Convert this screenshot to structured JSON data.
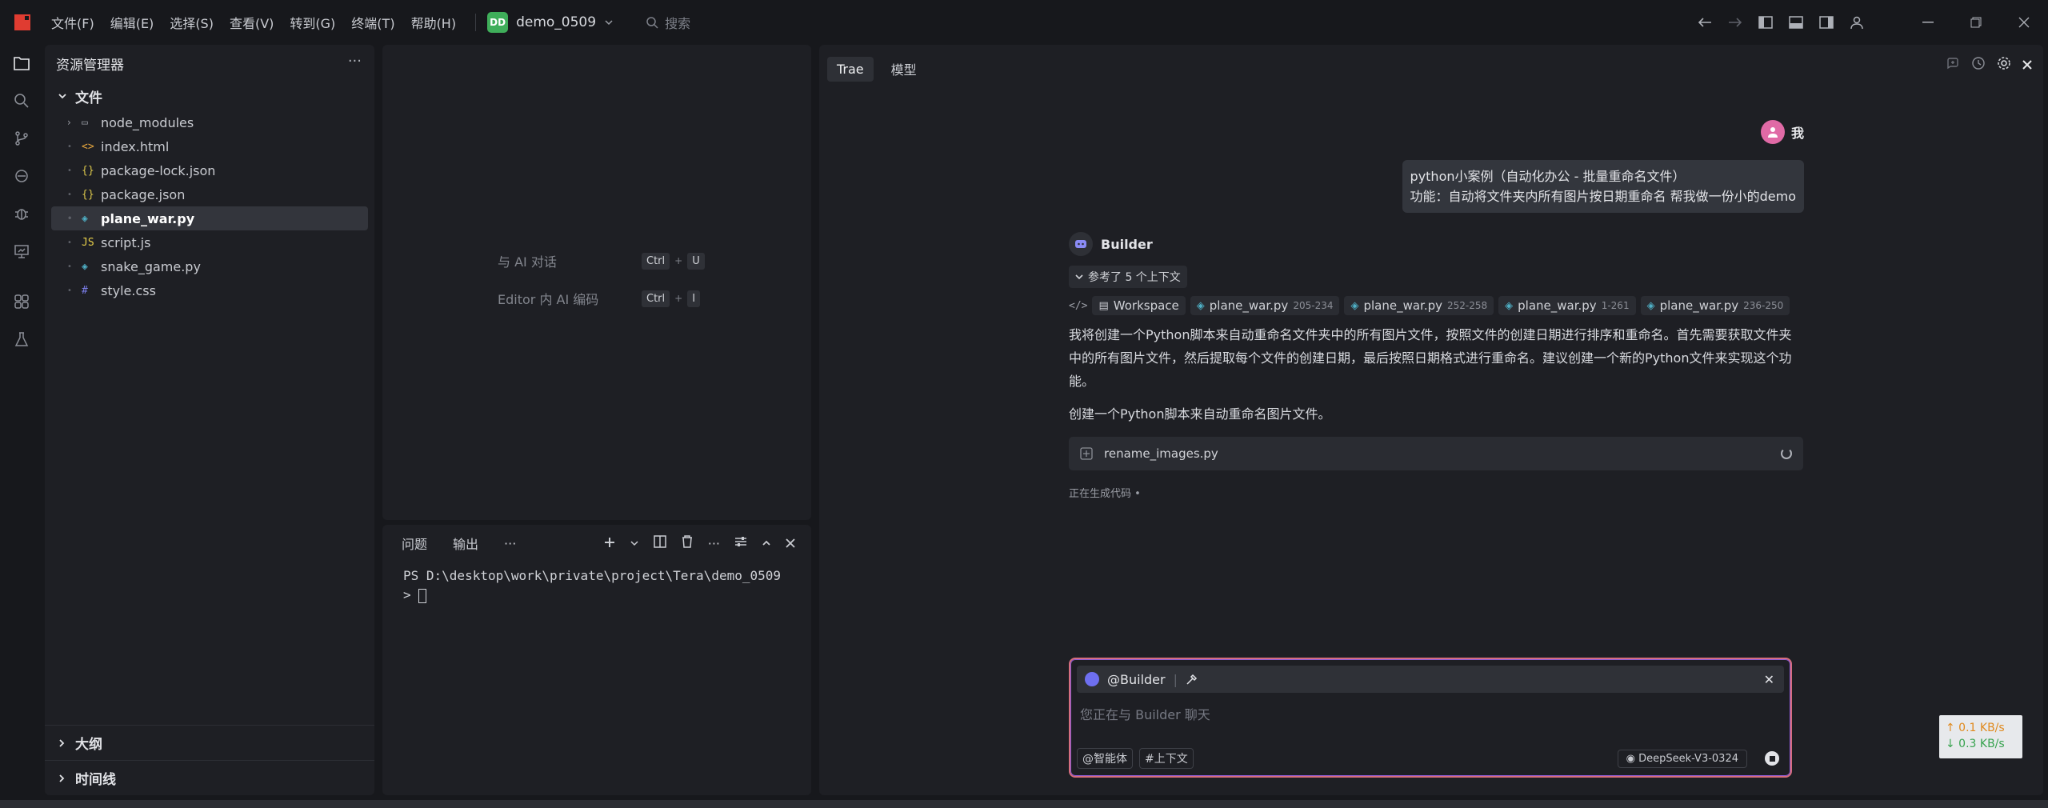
{
  "menu": [
    "文件(F)",
    "编辑(E)",
    "选择(S)",
    "查看(V)",
    "转到(G)",
    "终端(T)",
    "帮助(H)"
  ],
  "workspace": {
    "badge": "DD",
    "name": "demo_0509"
  },
  "search": {
    "placeholder": "搜索"
  },
  "explorer": {
    "title": "资源管理器",
    "section": "文件",
    "items": [
      {
        "name": "node_modules",
        "icon": "folder-icon",
        "color": "#9a9da5"
      },
      {
        "name": "index.html",
        "icon": "html-icon",
        "color": "#e5a53d"
      },
      {
        "name": "package-lock.json",
        "icon": "json-icon",
        "color": "#d6c24a"
      },
      {
        "name": "package.json",
        "icon": "json-icon",
        "color": "#d6c24a"
      },
      {
        "name": "plane_war.py",
        "icon": "python-icon",
        "color": "#4fb0c6"
      },
      {
        "name": "script.js",
        "icon": "js-icon",
        "color": "#e8d04a"
      },
      {
        "name": "snake_game.py",
        "icon": "python-icon",
        "color": "#4fb0c6"
      },
      {
        "name": "style.css",
        "icon": "css-icon",
        "color": "#7a7de8"
      }
    ],
    "selected": "plane_war.py",
    "outline": "大纲",
    "timeline": "时间线"
  },
  "editor": {
    "shortcuts": [
      {
        "label": "与 AI 对话",
        "key1": "Ctrl",
        "key2": "U"
      },
      {
        "label": "Editor 内 AI 编码",
        "key1": "Ctrl",
        "key2": "I"
      }
    ]
  },
  "terminal": {
    "tabs": [
      "问题",
      "输出",
      "···"
    ],
    "line1": "PS D:\\desktop\\work\\private\\project\\Tera\\demo_0509",
    "line2": "> "
  },
  "chat": {
    "tabs": [
      "Trae",
      "模型"
    ],
    "user": {
      "name": "我",
      "message_line1": "python小案例（自动化办公 - 批量重命名文件）",
      "message_line2": "功能：自动将文件夹内所有图片按日期重命名 帮我做一份小的demo"
    },
    "bot": {
      "name": "Builder",
      "context_toggle": "参考了 5 个上下文",
      "refs": [
        {
          "name": "Workspace",
          "range": ""
        },
        {
          "name": "plane_war.py",
          "range": "205-234"
        },
        {
          "name": "plane_war.py",
          "range": "252-258"
        },
        {
          "name": "plane_war.py",
          "range": "1-261"
        },
        {
          "name": "plane_war.py",
          "range": "236-250"
        }
      ],
      "para1": "我将创建一个Python脚本来自动重命名文件夹中的所有图片文件，按照文件的创建日期进行排序和重命名。首先需要获取文件夹中的所有图片文件，然后提取每个文件的创建日期，最后按照日期格式进行重命名。建议创建一个新的Python文件来实现这个功能。",
      "para2": "创建一个Python脚本来自动重命名图片文件。",
      "file": "rename_images.py",
      "status": "正在生成代码 •"
    },
    "input": {
      "agent": "@Builder",
      "placeholder": "您正在与 Builder 聊天",
      "btn_agent": "@智能体",
      "btn_context": "#上下文",
      "model": "DeepSeek-V3-0324"
    }
  },
  "network": {
    "up": "↑ 0.1 KB/s",
    "down": "↓ 0.3 KB/s"
  }
}
